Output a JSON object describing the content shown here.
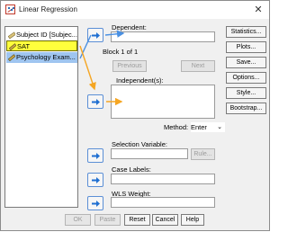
{
  "window": {
    "title": "Linear Regression",
    "close_glyph": "✕"
  },
  "variables": [
    {
      "label": "Subject ID [Subjec...",
      "icon": "ruler-scale-icon",
      "state": "normal"
    },
    {
      "label": "SAT",
      "icon": "pencil-scale-icon",
      "state": "highlighted-yellow"
    },
    {
      "label": "Psychology Exam...",
      "icon": "pencil-scale-icon",
      "state": "highlighted-blue"
    }
  ],
  "dependent": {
    "label": "Dependent:",
    "value": ""
  },
  "block": {
    "label": "Block 1 of 1",
    "previous": "Previous",
    "next": "Next"
  },
  "independents": {
    "label": "Independent(s):",
    "value": ""
  },
  "method": {
    "label": "Method:",
    "selected": "Enter",
    "chevron": "⌄"
  },
  "selection_variable": {
    "label": "Selection Variable:",
    "value": "",
    "rule_button": "Rule..."
  },
  "case_labels": {
    "label": "Case Labels:",
    "value": ""
  },
  "wls_weight": {
    "label": "WLS Weight:",
    "value": ""
  },
  "side_buttons": [
    "Statistics...",
    "Plots...",
    "Save...",
    "Options...",
    "Style...",
    "Bootstrap..."
  ],
  "bottom_buttons": [
    "OK",
    "Paste",
    "Reset",
    "Cancel",
    "Help"
  ],
  "colors": {
    "highlight_yellow": "#ffff3c",
    "highlight_blue": "#9fc5f0",
    "arrow_blue": "#1f6fd1",
    "annotation_blue": "#4a90e2",
    "annotation_orange": "#f5a623"
  }
}
